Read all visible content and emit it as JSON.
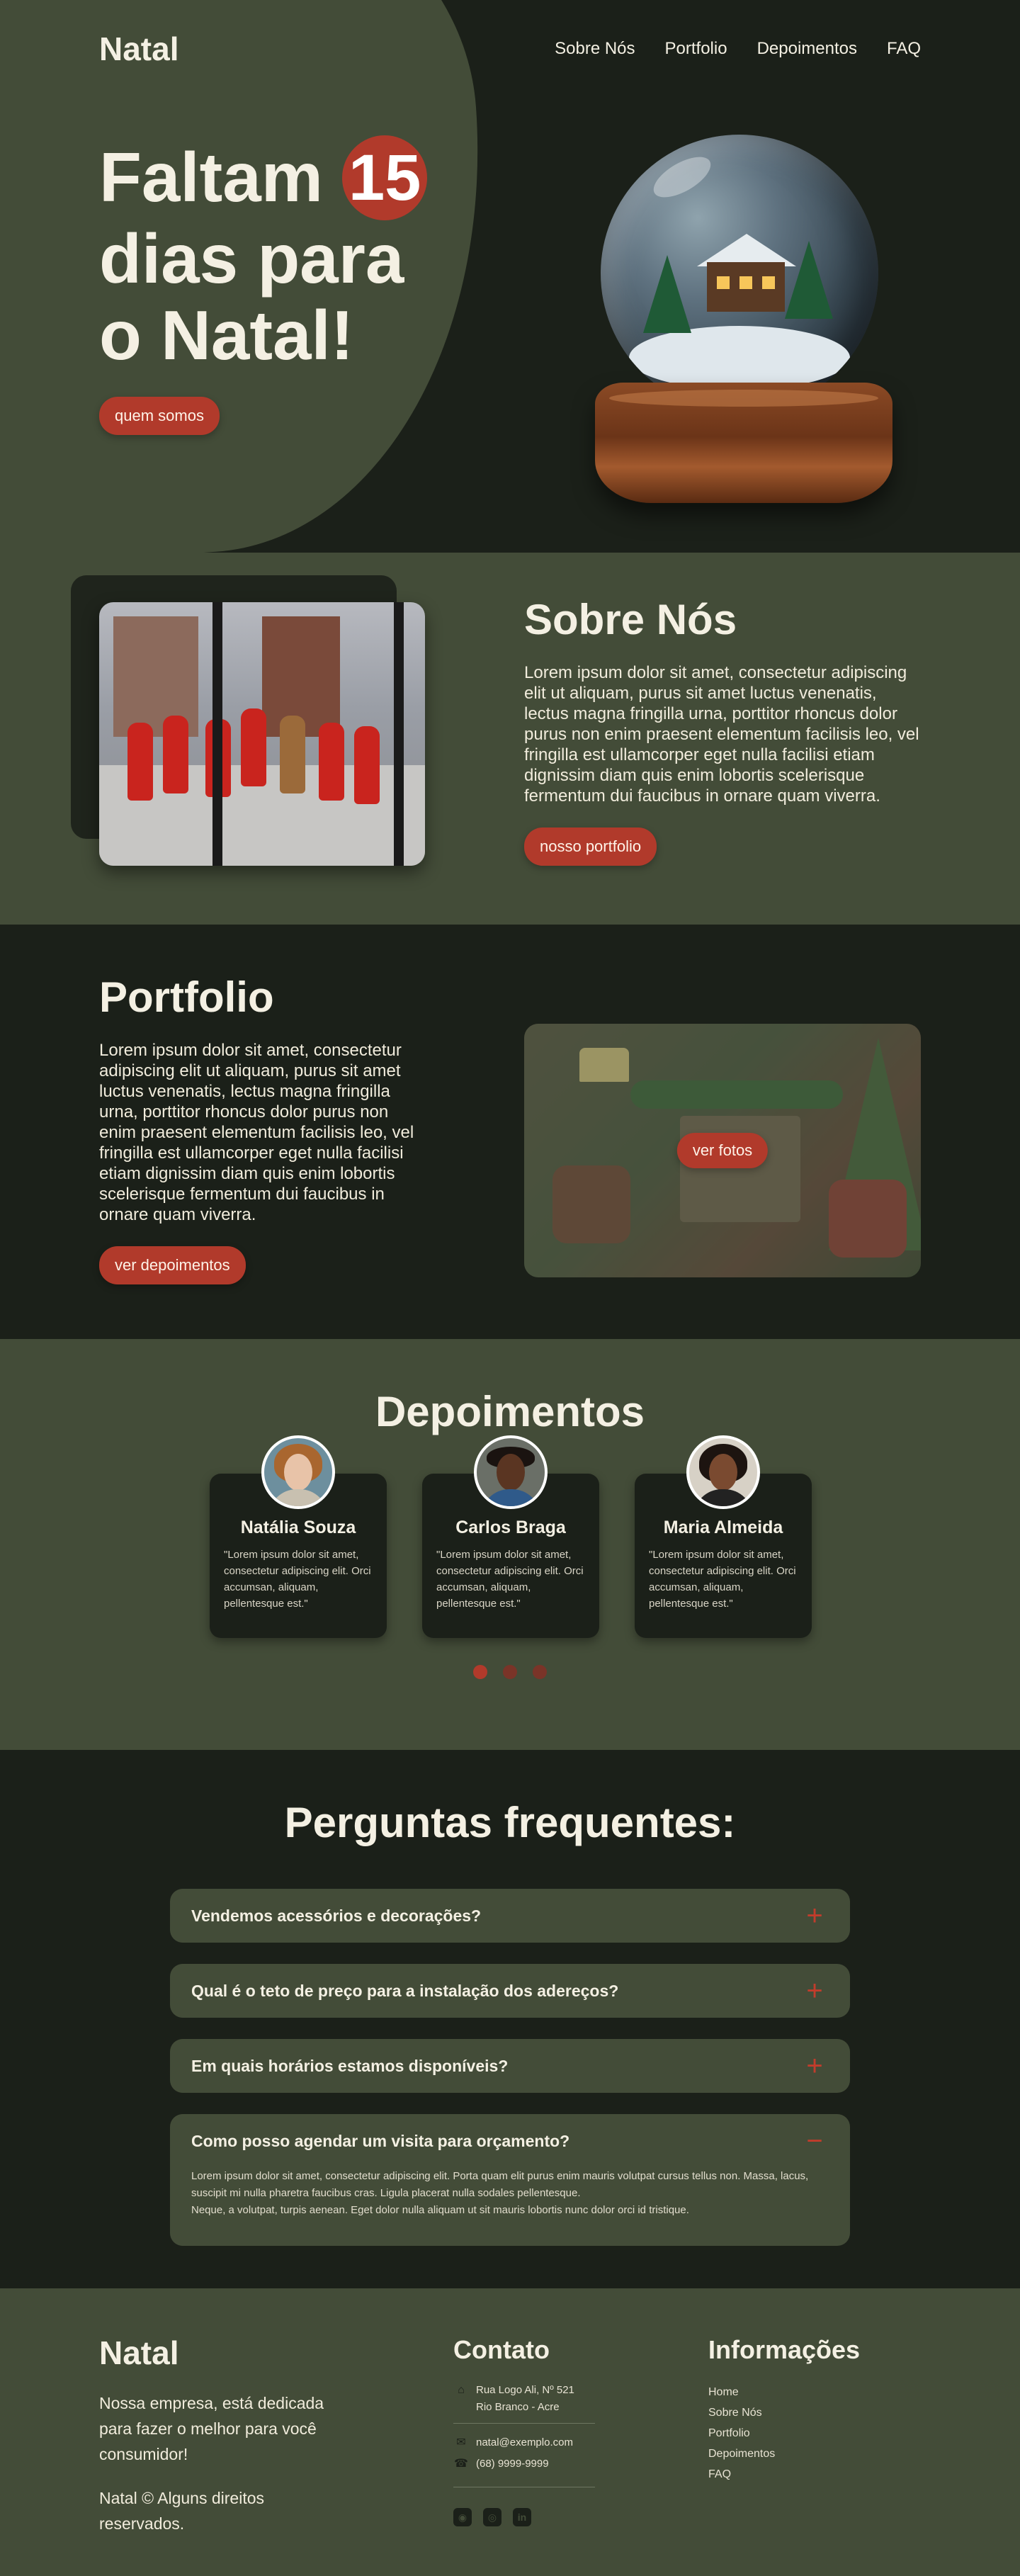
{
  "brand": "Natal",
  "nav": {
    "items": [
      "Sobre Nós",
      "Portfolio",
      "Depoimentos",
      "FAQ"
    ]
  },
  "hero": {
    "title_line1": "Faltam",
    "days": "15",
    "title_line2": "dias para",
    "title_line3": "o Natal!",
    "button": "quem somos"
  },
  "sobre": {
    "title": "Sobre Nós",
    "text": "Lorem ipsum dolor sit amet, consectetur adipiscing elit ut aliquam, purus sit amet luctus venenatis, lectus magna fringilla urna, porttitor rhoncus dolor purus non enim praesent elementum facilisis leo, vel fringilla est ullamcorper eget nulla facilisi etiam dignissim diam quis enim lobortis scelerisque fermentum dui faucibus in ornare quam viverra.",
    "button": "nosso portfolio"
  },
  "portfolio": {
    "title": "Portfolio",
    "text": "Lorem ipsum dolor sit amet, consectetur adipiscing elit ut aliquam, purus sit amet luctus venenatis, lectus magna fringilla urna, porttitor rhoncus dolor purus non enim praesent elementum facilisis leo, vel fringilla est ullamcorper eget nulla facilisi etiam dignissim diam quis enim lobortis scelerisque fermentum dui faucibus in ornare quam viverra.",
    "button": "ver depoimentos",
    "image_button": "ver fotos"
  },
  "depoimentos": {
    "title": "Depoimentos",
    "cards": [
      {
        "name": "Natália Souza",
        "quote": "\"Lorem ipsum dolor sit amet, consectetur adipiscing elit. Orci accumsan, aliquam, pellentesque est.\""
      },
      {
        "name": "Carlos Braga",
        "quote": "\"Lorem ipsum dolor sit amet, consectetur adipiscing elit. Orci accumsan, aliquam, pellentesque est.\""
      },
      {
        "name": "Maria Almeida",
        "quote": "\"Lorem ipsum dolor sit amet, consectetur adipiscing elit. Orci accumsan, aliquam, pellentesque est.\""
      }
    ],
    "active_dot": 1
  },
  "faq": {
    "title": "Perguntas frequentes:",
    "items": [
      {
        "q": "Vendemos acessórios e decorações?",
        "icon": "+"
      },
      {
        "q": "Qual é o teto de preço para a instalação dos adereços?",
        "icon": "+"
      },
      {
        "q": "Em quais horários estamos disponíveis?",
        "icon": "+"
      },
      {
        "q": "Como posso agendar um visita para orçamento?",
        "icon": "−",
        "a1": "Lorem ipsum dolor sit amet, consectetur adipiscing elit. Porta quam elit purus enim mauris volutpat cursus tellus non. Massa, lacus, suscipit mi nulla pharetra faucibus cras. Ligula placerat nulla sodales pellentesque.",
        "a2": "Neque, a volutpat, turpis aenean. Eget dolor nulla aliquam ut sit mauris lobortis nunc dolor orci id tristique."
      }
    ]
  },
  "footer": {
    "logo": "Natal",
    "about": "Nossa empresa, está dedicada para fazer o melhor para você consumidor!",
    "copyright": "Natal © Alguns direitos reservados.",
    "contact_title": "Contato",
    "address1": "Rua Logo Ali, Nº 521",
    "address2": "Rio Branco - Acre",
    "email": "natal@exemplo.com",
    "phone": "(68) 9999-9999",
    "info_title": "Informações",
    "info_links": [
      "Home",
      "Sobre Nós",
      "Portfolio",
      "Depoimentos",
      "FAQ"
    ]
  },
  "colors": {
    "dark_green": "#1b2019",
    "olive": "#434c38",
    "accent_red": "#b13a2b",
    "cream": "#f4f0e3"
  },
  "icons": [
    "home-icon",
    "mail-icon",
    "phone-icon",
    "github-icon",
    "instagram-icon",
    "linkedin-icon",
    "plus-icon",
    "minus-icon"
  ]
}
